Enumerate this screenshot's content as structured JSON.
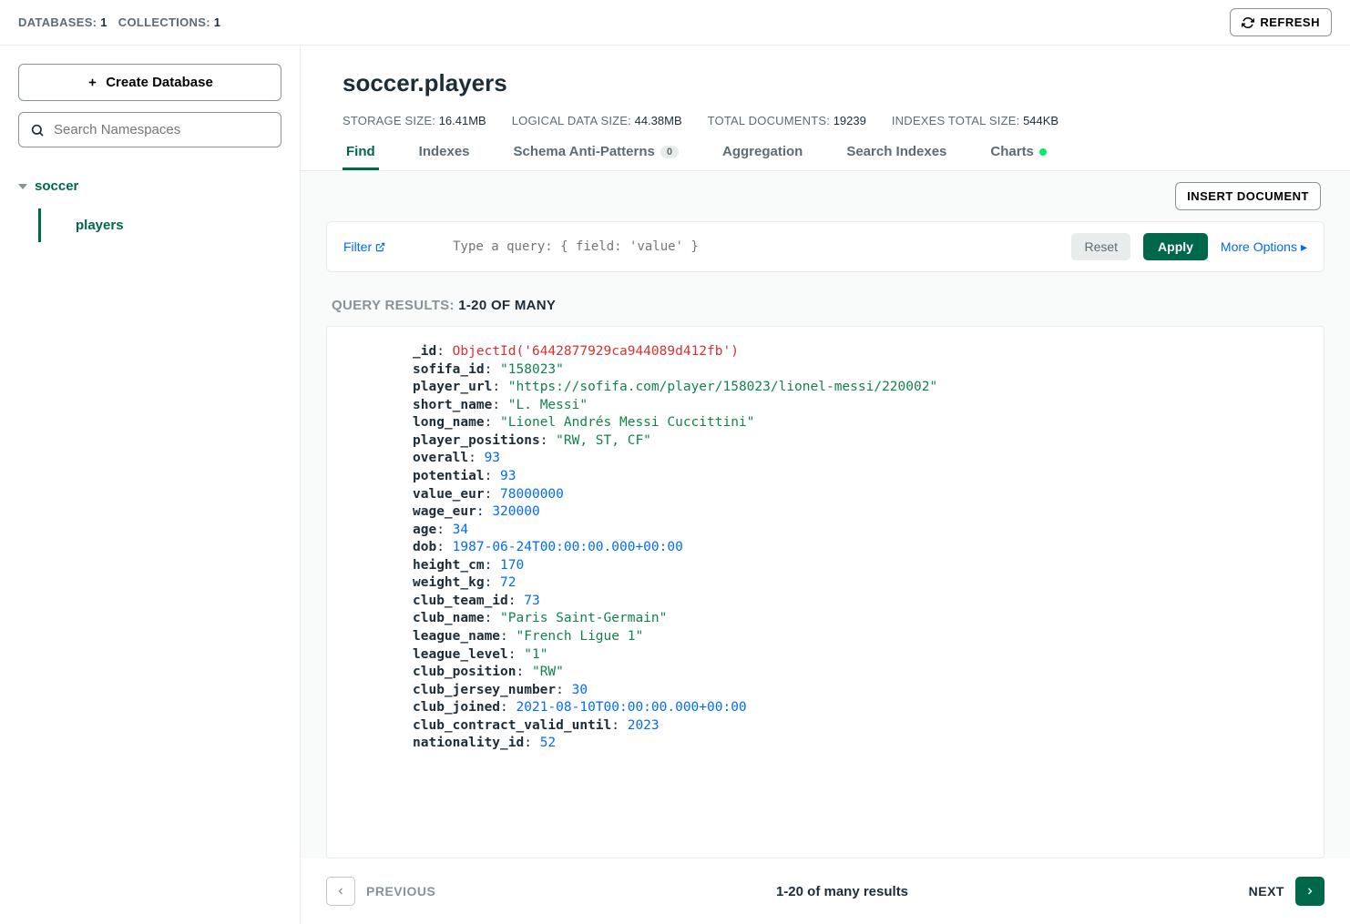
{
  "topbar": {
    "databases_label": "DATABASES:",
    "databases_count": "1",
    "collections_label": "COLLECTIONS:",
    "collections_count": "1",
    "refresh_label": "REFRESH"
  },
  "sidebar": {
    "create_db_label": "Create Database",
    "search_placeholder": "Search Namespaces",
    "db_name": "soccer",
    "collection_name": "players"
  },
  "header": {
    "title": "soccer.players",
    "stats": {
      "storage_label": "STORAGE SIZE:",
      "storage_val": "16.41MB",
      "logical_label": "LOGICAL DATA SIZE:",
      "logical_val": "44.38MB",
      "totaldocs_label": "TOTAL DOCUMENTS:",
      "totaldocs_val": "19239",
      "indexes_label": "INDEXES TOTAL SIZE:",
      "indexes_val": "544KB"
    }
  },
  "tabs": {
    "find": "Find",
    "indexes": "Indexes",
    "schema": "Schema Anti-Patterns",
    "schema_badge": "0",
    "aggregation": "Aggregation",
    "search_indexes": "Search Indexes",
    "charts": "Charts"
  },
  "toolbar": {
    "insert_label": "INSERT DOCUMENT",
    "filter_label": "Filter",
    "query_placeholder": "Type a query: { field: 'value' }",
    "reset_label": "Reset",
    "apply_label": "Apply",
    "more_options_label": "More Options"
  },
  "results": {
    "label_prefix": "QUERY RESULTS:",
    "label_strong": "1-20 OF MANY"
  },
  "document": {
    "fields": [
      {
        "k": "_id",
        "v": "ObjectId('6442877929ca944089d412fb')",
        "t": "oid"
      },
      {
        "k": "sofifa_id",
        "v": "\"158023\"",
        "t": "str"
      },
      {
        "k": "player_url",
        "v": "\"https://sofifa.com/player/158023/lionel-messi/220002\"",
        "t": "str"
      },
      {
        "k": "short_name",
        "v": "\"L. Messi\"",
        "t": "str"
      },
      {
        "k": "long_name",
        "v": "\"Lionel Andrés Messi Cuccittini\"",
        "t": "str"
      },
      {
        "k": "player_positions",
        "v": "\"RW, ST, CF\"",
        "t": "str"
      },
      {
        "k": "overall",
        "v": "93",
        "t": "num"
      },
      {
        "k": "potential",
        "v": "93",
        "t": "num"
      },
      {
        "k": "value_eur",
        "v": "78000000",
        "t": "num"
      },
      {
        "k": "wage_eur",
        "v": "320000",
        "t": "num"
      },
      {
        "k": "age",
        "v": "34",
        "t": "num"
      },
      {
        "k": "dob",
        "v": "1987-06-24T00:00:00.000+00:00",
        "t": "num"
      },
      {
        "k": "height_cm",
        "v": "170",
        "t": "num"
      },
      {
        "k": "weight_kg",
        "v": "72",
        "t": "num"
      },
      {
        "k": "club_team_id",
        "v": "73",
        "t": "num"
      },
      {
        "k": "club_name",
        "v": "\"Paris Saint-Germain\"",
        "t": "str"
      },
      {
        "k": "league_name",
        "v": "\"French Ligue 1\"",
        "t": "str"
      },
      {
        "k": "league_level",
        "v": "\"1\"",
        "t": "str"
      },
      {
        "k": "club_position",
        "v": "\"RW\"",
        "t": "str"
      },
      {
        "k": "club_jersey_number",
        "v": "30",
        "t": "num"
      },
      {
        "k": "club_joined",
        "v": "2021-08-10T00:00:00.000+00:00",
        "t": "num"
      },
      {
        "k": "club_contract_valid_until",
        "v": "2023",
        "t": "num"
      },
      {
        "k": "nationality_id",
        "v": "52",
        "t": "num"
      }
    ]
  },
  "pager": {
    "previous": "PREVIOUS",
    "center": "1-20 of many results",
    "next": "NEXT"
  }
}
